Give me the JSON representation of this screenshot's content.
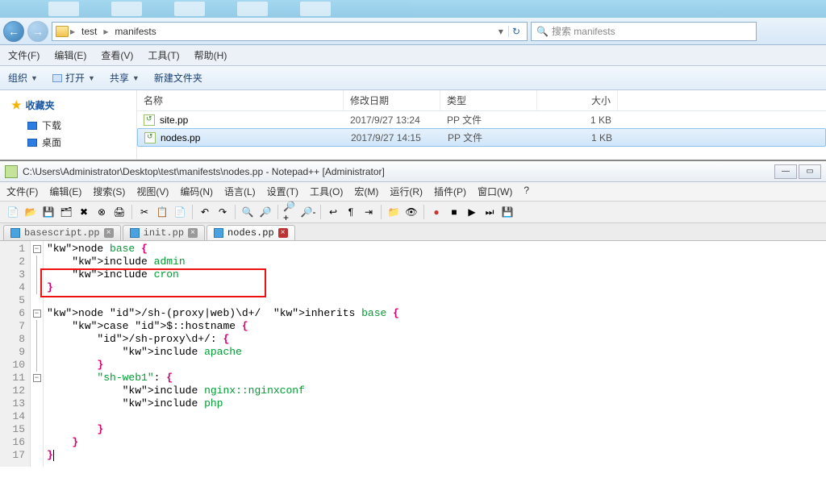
{
  "explorer": {
    "breadcrumbs": [
      "test",
      "manifests"
    ],
    "search_placeholder": "搜索 manifests",
    "menus": [
      "文件(F)",
      "编辑(E)",
      "查看(V)",
      "工具(T)",
      "帮助(H)"
    ],
    "toolbar": {
      "organize": "组织",
      "open": "打开",
      "share": "共享",
      "newfolder": "新建文件夹"
    },
    "sidebar": {
      "favorites": "收藏夹",
      "downloads": "下载",
      "desktop": "桌面"
    },
    "columns": {
      "name": "名称",
      "date": "修改日期",
      "type": "类型",
      "size": "大小"
    },
    "files": [
      {
        "name": "site.pp",
        "date": "2017/9/27 13:24",
        "type": "PP 文件",
        "size": "1 KB"
      },
      {
        "name": "nodes.pp",
        "date": "2017/9/27 14:15",
        "type": "PP 文件",
        "size": "1 KB"
      }
    ]
  },
  "npp": {
    "title": "C:\\Users\\Administrator\\Desktop\\test\\manifests\\nodes.pp - Notepad++ [Administrator]",
    "menus": [
      "文件(F)",
      "编辑(E)",
      "搜索(S)",
      "视图(V)",
      "编码(N)",
      "语言(L)",
      "设置(T)",
      "工具(O)",
      "宏(M)",
      "运行(R)",
      "插件(P)",
      "窗口(W)",
      "?"
    ],
    "tabs": [
      {
        "label": "basescript.pp",
        "active": false
      },
      {
        "label": "init.pp",
        "active": false
      },
      {
        "label": "nodes.pp",
        "active": true
      }
    ],
    "code_lines": [
      "node base {",
      "    include admin",
      "    include cron",
      "}",
      "",
      "node /sh-(proxy|web)\\d+/  inherits base {",
      "    case $::hostname {",
      "        /sh-proxy\\d+/: {",
      "            include apache",
      "        }",
      "        \"sh-web1\": {",
      "            include nginx::nginxconf",
      "            include php",
      "",
      "        }",
      "    }",
      "}"
    ]
  }
}
